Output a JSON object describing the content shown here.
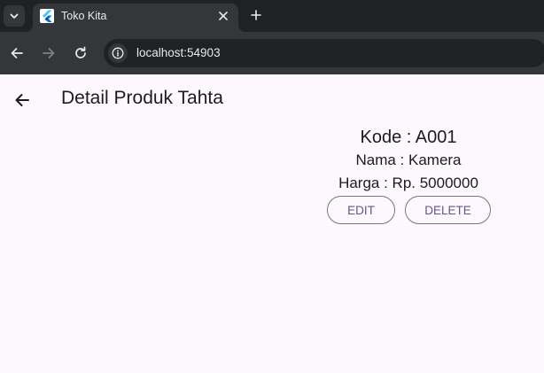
{
  "browser": {
    "tab": {
      "title": "Toko Kita"
    },
    "address_bar": {
      "url": "localhost:54903"
    }
  },
  "app": {
    "title": "Detail Produk Tahta",
    "product": {
      "kode": "Kode : A001",
      "nama": "Nama : Kamera",
      "harga": "Harga : Rp. 5000000"
    },
    "buttons": {
      "edit": "EDIT",
      "delete": "DELETE"
    }
  },
  "colors": {
    "page_background": "#fdf7fe",
    "button_text": "#65558f",
    "button_border": "#79747e",
    "flutter_logo": "#0468d7"
  },
  "icons": [
    "tab-list-icon",
    "flutter-logo-icon",
    "close-icon",
    "plus-icon",
    "back-arrow-icon",
    "forward-arrow-icon",
    "reload-icon",
    "info-icon",
    "arrow-back-icon"
  ]
}
